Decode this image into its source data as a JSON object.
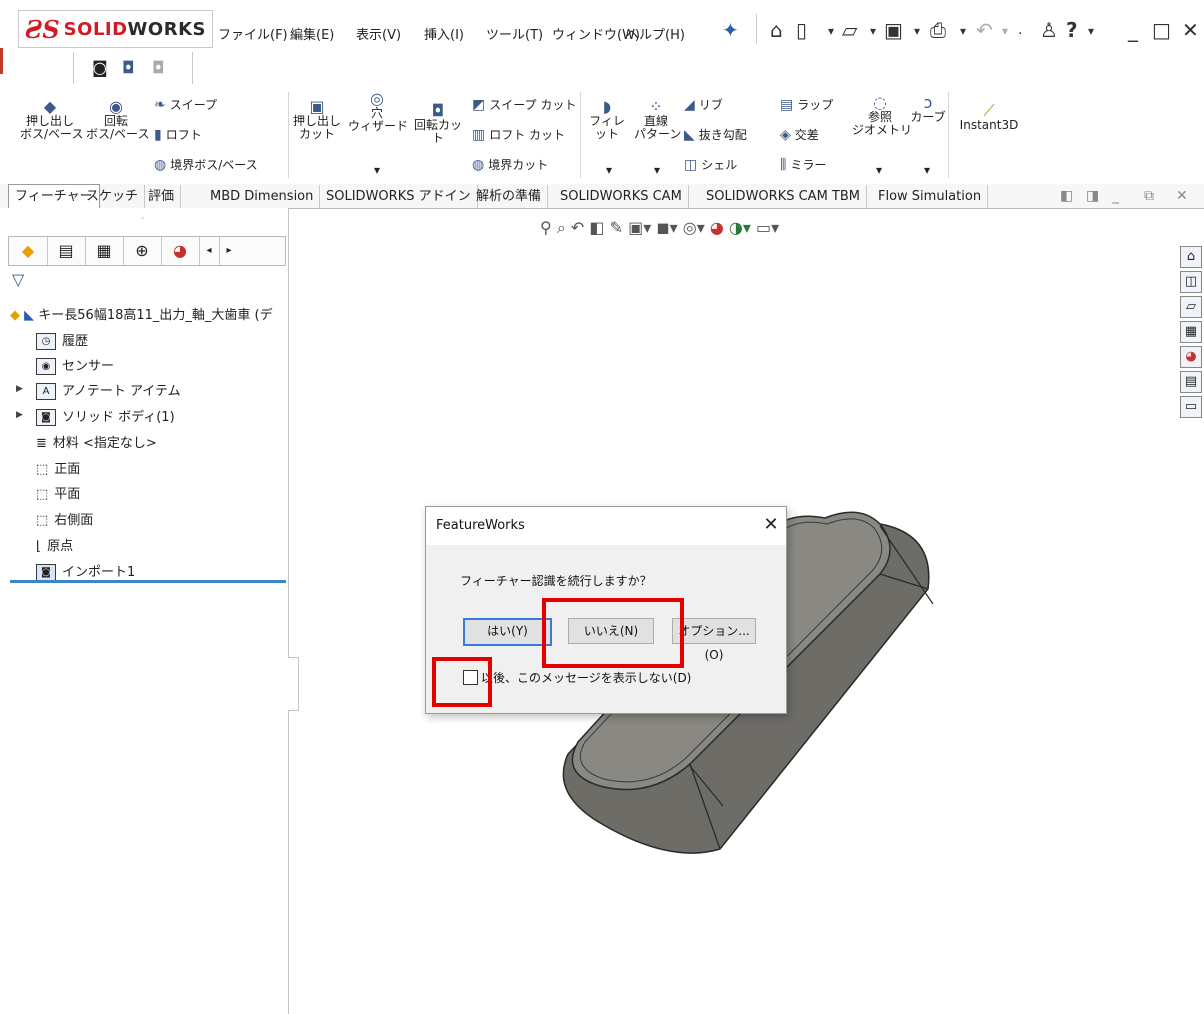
{
  "app": {
    "logo_ds": "ƧS",
    "logo_text_a": "SOLID",
    "logo_text_b": "WORKS"
  },
  "menu": [
    "ファイル(F)",
    "編集(E)",
    "表示(V)",
    "挿入(I)",
    "ツール(T)",
    "ウィンドウ(W)",
    "ヘルプ(H)"
  ],
  "ribbon": {
    "extrude_boss": "押し出し\nボス/ベース",
    "revolve_boss": "回転\nボス/ベース",
    "sweep": "スイープ",
    "loft": "ロフト",
    "boundary_boss": "境界ボス/ベース",
    "extrude_cut": "押し出し\nカット",
    "hole_wizard": "穴\nウィザード",
    "revolve_cut": "回転カット",
    "sweep_cut": "スイープ カット",
    "loft_cut": "ロフト カット",
    "boundary_cut": "境界カット",
    "fillet": "フィレット",
    "linear_pattern": "直線\nパターン",
    "rib": "リブ",
    "draft": "抜き勾配",
    "shell": "シェル",
    "wrap": "ラップ",
    "intersect": "交差",
    "mirror": "ミラー",
    "ref_geometry": "参照\nジオメトリ",
    "curves": "カーブ",
    "instant3d": "Instant3D"
  },
  "tabs": [
    "フィーチャー",
    "スケッチ",
    "評価",
    "MBD Dimension",
    "SOLIDWORKS アドイン",
    "解析の準備",
    "SOLIDWORKS CAM",
    "SOLIDWORKS CAM TBM",
    "Flow Simulation"
  ],
  "tree": {
    "root": "キー長56幅18高11_出力_軸_大歯車 (デ",
    "items": [
      "履歴",
      "センサー",
      "アノテート アイテム",
      "ソリッド ボディ(1)",
      "材料 <指定なし>",
      "正面",
      "平面",
      "右側面",
      "原点",
      "インポート1"
    ]
  },
  "dialog": {
    "title": "FeatureWorks",
    "close": "✕",
    "message": "フィーチャー認識を続行しますか？",
    "yes": "はい(Y)",
    "no": "いいえ(N)",
    "options": "オプション...(O)",
    "dont_show": "以後、このメッセージを表示しない(D)"
  },
  "colors": {
    "brand_red": "#d01c22",
    "highlight_red": "#e30000",
    "part_side": "#6e6c67",
    "part_top": "#8a8882"
  }
}
